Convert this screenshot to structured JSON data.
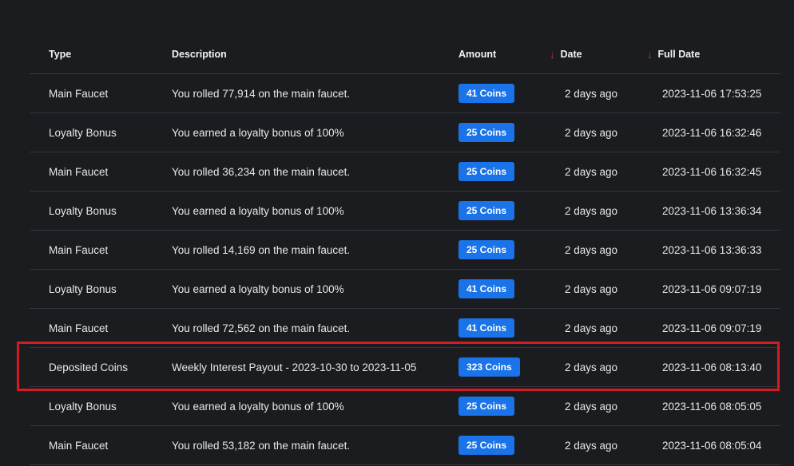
{
  "columns": {
    "type": "Type",
    "description": "Description",
    "amount": "Amount",
    "date": "Date",
    "full_date": "Full Date"
  },
  "sort_icon": "arrow-down-icon",
  "sort_color": "#d1334a",
  "badge_color": "#1a73e8",
  "highlight_color": "#d21c23",
  "highlighted_row_index": 7,
  "rows": [
    {
      "type": "Main Faucet",
      "description": "You rolled 77,914 on the main faucet.",
      "amount": "41 Coins",
      "date": "2 days ago",
      "full_date": "2023-11-06 17:53:25"
    },
    {
      "type": "Loyalty Bonus",
      "description": "You earned a loyalty bonus of 100%",
      "amount": "25 Coins",
      "date": "2 days ago",
      "full_date": "2023-11-06 16:32:46"
    },
    {
      "type": "Main Faucet",
      "description": "You rolled 36,234 on the main faucet.",
      "amount": "25 Coins",
      "date": "2 days ago",
      "full_date": "2023-11-06 16:32:45"
    },
    {
      "type": "Loyalty Bonus",
      "description": "You earned a loyalty bonus of 100%",
      "amount": "25 Coins",
      "date": "2 days ago",
      "full_date": "2023-11-06 13:36:34"
    },
    {
      "type": "Main Faucet",
      "description": "You rolled 14,169 on the main faucet.",
      "amount": "25 Coins",
      "date": "2 days ago",
      "full_date": "2023-11-06 13:36:33"
    },
    {
      "type": "Loyalty Bonus",
      "description": "You earned a loyalty bonus of 100%",
      "amount": "41 Coins",
      "date": "2 days ago",
      "full_date": "2023-11-06 09:07:19"
    },
    {
      "type": "Main Faucet",
      "description": "You rolled 72,562 on the main faucet.",
      "amount": "41 Coins",
      "date": "2 days ago",
      "full_date": "2023-11-06 09:07:19"
    },
    {
      "type": "Deposited Coins",
      "description": "Weekly Interest Payout - 2023-10-30 to 2023-11-05",
      "amount": "323 Coins",
      "date": "2 days ago",
      "full_date": "2023-11-06 08:13:40"
    },
    {
      "type": "Loyalty Bonus",
      "description": "You earned a loyalty bonus of 100%",
      "amount": "25 Coins",
      "date": "2 days ago",
      "full_date": "2023-11-06 08:05:05"
    },
    {
      "type": "Main Faucet",
      "description": "You rolled 53,182 on the main faucet.",
      "amount": "25 Coins",
      "date": "2 days ago",
      "full_date": "2023-11-06 08:05:04"
    }
  ]
}
